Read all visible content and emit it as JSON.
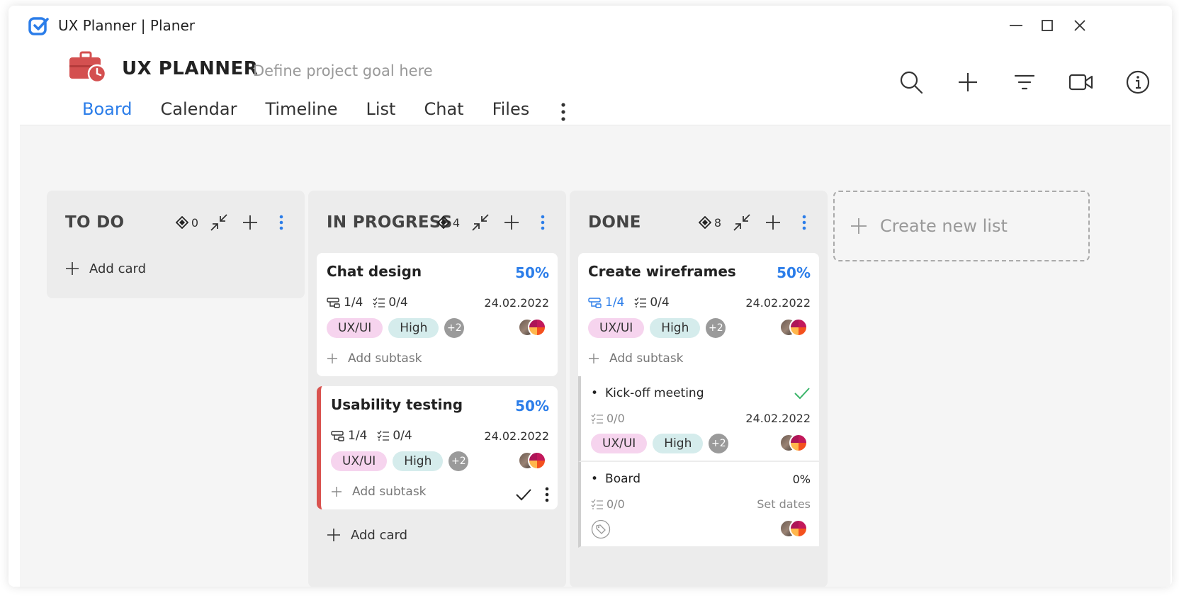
{
  "window": {
    "title": "UX Planner | Planer"
  },
  "project": {
    "title": "UX PLANNER",
    "goal_placeholder": "Define project goal here"
  },
  "tabs": [
    {
      "label": "Board",
      "active": true
    },
    {
      "label": "Calendar"
    },
    {
      "label": "Timeline"
    },
    {
      "label": "List"
    },
    {
      "label": "Chat"
    },
    {
      "label": "Files"
    }
  ],
  "toolbar": [
    "search-icon",
    "plus-icon",
    "filter-icon",
    "video-icon",
    "info-icon"
  ],
  "colors": {
    "accent": "#2b7de9",
    "danger": "#d9534f",
    "tag_uxui": "#f6d4ee",
    "tag_high": "#d5ecec"
  },
  "lists": {
    "todo": {
      "title": "TO DO",
      "count": "0",
      "add_card": "Add card"
    },
    "in_progress": {
      "title": "IN PROGRESS",
      "count": "4",
      "add_card": "Add card",
      "cards": [
        {
          "title": "Chat design",
          "percent": "50%",
          "subtasks": "1/4",
          "checklist": "0/4",
          "date": "24.02.2022",
          "tag1": "UX/UI",
          "tag2": "High",
          "more": "+2",
          "add_subtask": "Add subtask"
        },
        {
          "title": "Usability testing",
          "percent": "50%",
          "subtasks": "1/4",
          "checklist": "0/4",
          "date": "24.02.2022",
          "tag1": "UX/UI",
          "tag2": "High",
          "more": "+2",
          "add_subtask": "Add subtask"
        }
      ]
    },
    "done": {
      "title": "DONE",
      "count": "8",
      "cards": [
        {
          "title": "Create wireframes",
          "percent": "50%",
          "subtasks": "1/4",
          "checklist": "0/4",
          "date": "24.02.2022",
          "tag1": "UX/UI",
          "tag2": "High",
          "more": "+2",
          "add_subtask": "Add subtask"
        }
      ],
      "subtasks": [
        {
          "title": "Kick-off meeting",
          "checklist": "0/0",
          "date": "24.02.2022",
          "tag1": "UX/UI",
          "tag2": "High",
          "more": "+2"
        },
        {
          "title": "Board",
          "percent": "0%",
          "checklist": "0/0",
          "date": "Set dates"
        }
      ]
    }
  },
  "create_list": "Create new list"
}
